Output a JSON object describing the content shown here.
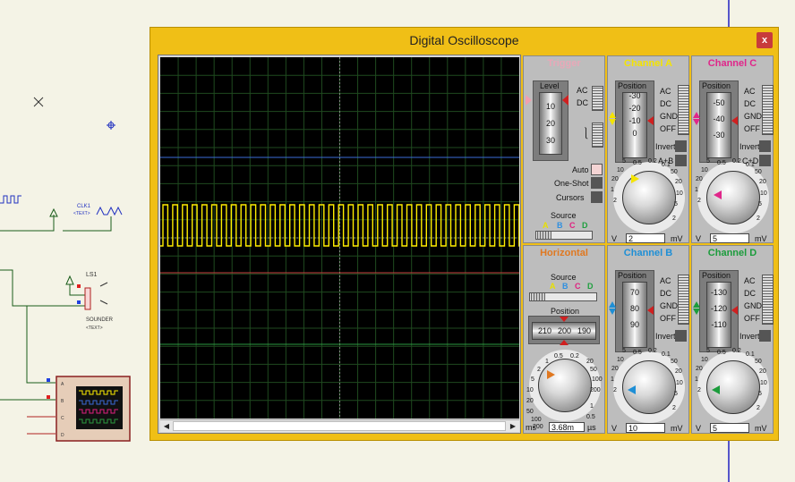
{
  "window": {
    "title": "Digital Oscilloscope",
    "close_label": "x"
  },
  "schematic": {
    "clk_label": "CLK1",
    "clk_text": "<TEXT>",
    "speaker_ref": "LS1",
    "speaker_name": "SOUNDER",
    "speaker_text": "<TEXT>",
    "pin_a": "A",
    "pin_b": "B",
    "pin_c": "C",
    "pin_d": "D"
  },
  "trigger": {
    "title": "Trigger",
    "level_label": "Level",
    "level_values": [
      "10",
      "20",
      "30"
    ],
    "coupling": [
      "AC",
      "DC"
    ],
    "modes": [
      "Auto",
      "One-Shot",
      "Cursors"
    ],
    "source_label": "Source",
    "sources": [
      "A",
      "B",
      "C",
      "D"
    ]
  },
  "channels": [
    {
      "title": "Channel A",
      "color": "#f4e400",
      "position_values": [
        "-30",
        "-20",
        "-10",
        "0"
      ],
      "volts": "2",
      "unit": "mV",
      "extra": "A+B"
    },
    {
      "title": "Channel C",
      "color": "#e0268a",
      "position_values": [
        "-50",
        "-40",
        "-30"
      ],
      "volts": "5",
      "unit": "mV",
      "extra": "C+D"
    },
    {
      "title": "Channel B",
      "color": "#1e8fd6",
      "position_values": [
        "70",
        "80",
        "90"
      ],
      "volts": "10",
      "unit": "mV",
      "extra": ""
    },
    {
      "title": "Channel D",
      "color": "#1c9c3c",
      "position_values": [
        "-130",
        "-120",
        "-110"
      ],
      "volts": "5",
      "unit": "mV",
      "extra": ""
    }
  ],
  "channel_modes": [
    "AC",
    "DC",
    "GND",
    "OFF"
  ],
  "invert_label": "Invert",
  "position_label": "Position",
  "volt_dial": {
    "ticks": [
      "0.5",
      "0.2",
      "0.1",
      "50",
      "20",
      "10",
      "5",
      "2",
      "1",
      "20",
      "10",
      "5",
      "2"
    ],
    "left_unit": "V"
  },
  "horizontal": {
    "title": "Horizontal",
    "source_label": "Source",
    "sources": [
      "A",
      "B",
      "C",
      "D"
    ],
    "position_label": "Position",
    "position_values": [
      "210",
      "200",
      "190"
    ],
    "timebase": "3.68m",
    "unit_left": "ms",
    "unit_right": "µs",
    "dial_ticks": [
      "0.5",
      "0.2",
      "1",
      "2",
      "5",
      "10",
      "20",
      "50",
      "100",
      "200",
      "20",
      "50",
      "100",
      "200",
      "0.5",
      "1"
    ]
  },
  "colors": {
    "trace_a": "#ffee00",
    "ref_b": "#3a6bd8",
    "ref_c": "#c84040",
    "ref_d": "#2a9a40",
    "grid": "#1f4a1f"
  }
}
